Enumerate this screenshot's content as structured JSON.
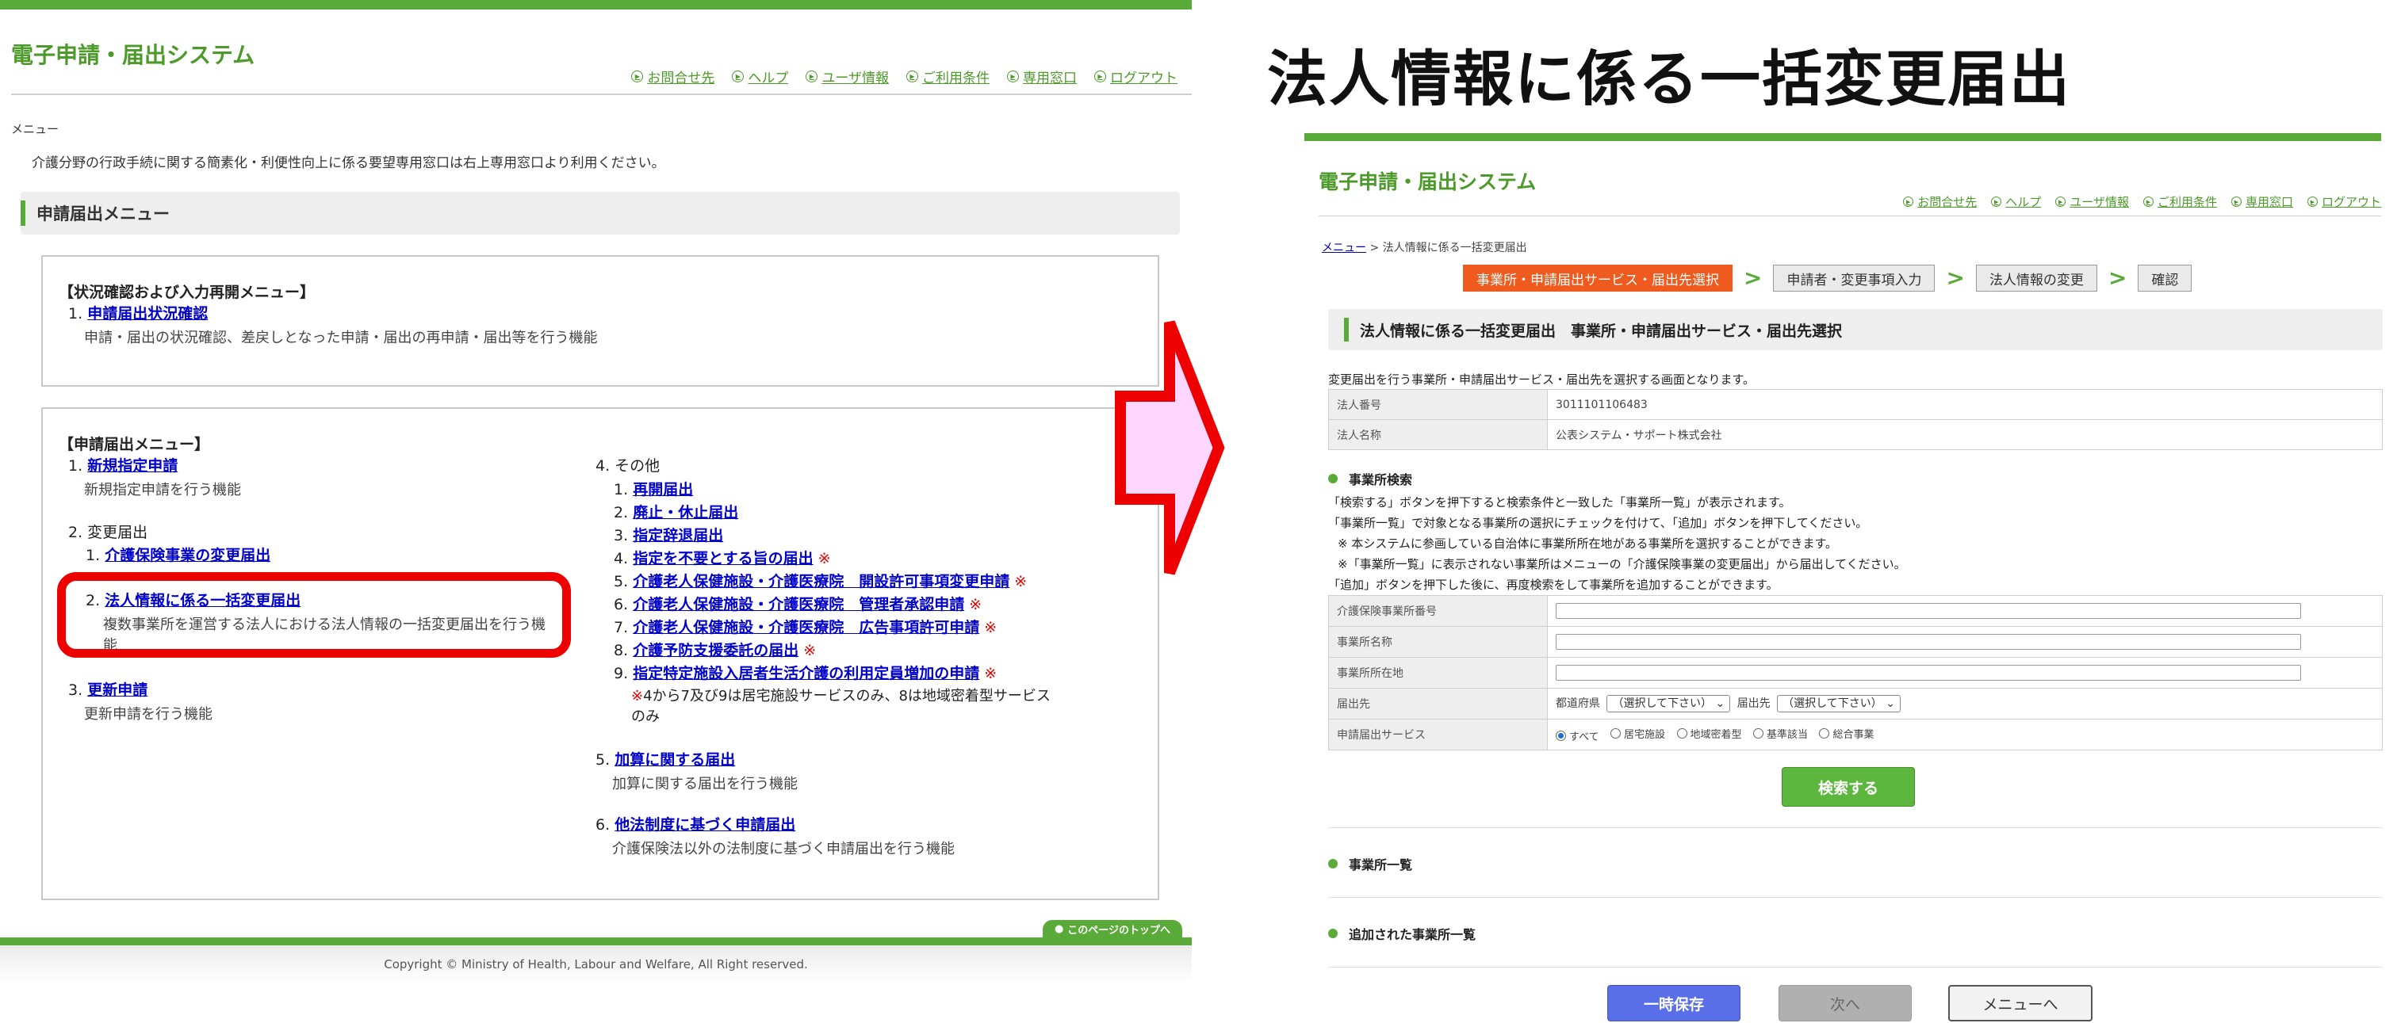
{
  "colors": {
    "brand_green": "#5aaa3a",
    "link_blue": "#0000cc",
    "highlight_red": "#ee0000",
    "arrow_fill": "#ffd6ff",
    "step_active": "#ef5a1e",
    "search_button": "#5db73e",
    "save_button": "#5a6ee8"
  },
  "left": {
    "system_title": "電子申請・届出システム",
    "toplinks": [
      {
        "label": "お問合せ先",
        "icon": "circle-arrow-icon"
      },
      {
        "label": "ヘルプ",
        "icon": "circle-arrow-icon"
      },
      {
        "label": "ユーザ情報",
        "icon": "circle-arrow-icon"
      },
      {
        "label": "ご利用条件",
        "icon": "circle-arrow-icon"
      },
      {
        "label": "専用窓口",
        "icon": "circle-arrow-icon"
      },
      {
        "label": "ログアウト",
        "icon": "circle-arrow-icon"
      }
    ],
    "menu_label": "メニュー",
    "notice": "介護分野の行政手続に関する簡素化・利便性向上に係る要望専用窓口は右上専用窓口より利用ください。",
    "section_title": "申請届出メニュー",
    "status_box": {
      "title": "【状況確認および入力再開メニュー】",
      "item_num": "1.",
      "item_link": "申請届出状況確認",
      "item_desc": "申請・届出の状況確認、差戻しとなった申請・届出の再申請・届出等を行う機能"
    },
    "menu_box": {
      "title": "【申請届出メニュー】",
      "i1_num": "1.",
      "i1_link": "新規指定申請",
      "i1_desc": "新規指定申請を行う機能",
      "i2_label": "2. 変更届出",
      "i2_1_num": "1.",
      "i2_1_link": "介護保険事業の変更届出",
      "i2_2_num": "2.",
      "i2_2_link": "法人情報に係る一括変更届出",
      "i2_2_desc_1": "複数事業所を運営する法人における法人情報の一括変更届出を行う機",
      "i2_2_desc_2": "能",
      "i3_num": "3.",
      "i3_link": "更新申請",
      "i3_desc": "更新申請を行う機能",
      "i4_label": "4. その他",
      "others": [
        {
          "num": "1.",
          "link": "再開届出",
          "mark": ""
        },
        {
          "num": "2.",
          "link": "廃止・休止届出",
          "mark": ""
        },
        {
          "num": "3.",
          "link": "指定辞退届出",
          "mark": ""
        },
        {
          "num": "4.",
          "link": "指定を不要とする旨の届出",
          "mark": "※"
        },
        {
          "num": "5.",
          "link": "介護老人保健施設・介護医療院　開設許可事項変更申請",
          "mark": "※"
        },
        {
          "num": "6.",
          "link": "介護老人保健施設・介護医療院　管理者承認申請",
          "mark": "※"
        },
        {
          "num": "7.",
          "link": "介護老人保健施設・介護医療院　広告事項許可申請",
          "mark": "※"
        },
        {
          "num": "8.",
          "link": "介護予防支援委託の届出",
          "mark": "※"
        },
        {
          "num": "9.",
          "link": "指定特定施設入居者生活介護の利用定員増加の申請",
          "mark": "※"
        }
      ],
      "note_mark": "※",
      "note_1": "4から7及び9は居宅施設サービスのみ、8は地域密着型サービス",
      "note_2": "のみ",
      "i5_num": "5.",
      "i5_link": "加算に関する届出",
      "i5_desc": "加算に関する届出を行う機能",
      "i6_num": "6.",
      "i6_link": "他法制度に基づく申請届出",
      "i6_desc": "介護保険法以外の法制度に基づく申請届出を行う機能"
    },
    "page_top": "このページのトップへ",
    "copyright": "Copyright © Ministry of Health, Labour and Welfare, All Right reserved."
  },
  "right": {
    "big_title": "法人情報に係る一括変更届出",
    "system_title": "電子申請・届出システム",
    "toplinks": [
      "お問合せ先",
      "ヘルプ",
      "ユーザ情報",
      "ご利用条件",
      "専用窓口",
      "ログアウト"
    ],
    "breadcrumb_link": "メニュー",
    "breadcrumb_sep": ">",
    "breadcrumb_current": "法人情報に係る一括変更届出",
    "steps": [
      "事業所・申請届出サービス・届出先選択",
      "申請者・変更事項入力",
      "法人情報の変更",
      "確認"
    ],
    "section_title": "法人情報に係る一括変更届出　事業所・申請届出サービス・届出先選択",
    "intro": "変更届出を行う事業所・申請届出サービス・届出先を選択する画面となります。",
    "corp_no_label": "法人番号",
    "corp_no_value": "3011101106483",
    "corp_name_label": "法人名称",
    "corp_name_value": "公表システム・サポート株式会社",
    "search_head": "事業所検索",
    "search_notes": [
      "「検索する」ボタンを押下すると検索条件と一致した「事業所一覧」が表示されます。",
      "「事業所一覧」で対象となる事業所の選択にチェックを付けて、「追加」ボタンを押下してください。",
      "※ 本システムに参画している自治体に事業所所在地がある事業所を選択することができます。",
      "※「事業所一覧」に表示されない事業所はメニューの「介護保険事業の変更届出」から届出してください。",
      "「追加」ボタンを押下した後に、再度検索をして事業所を追加することができます。"
    ],
    "form": {
      "office_no_label": "介護保険事業所番号",
      "office_name_label": "事業所名称",
      "office_addr_label": "事業所所在地",
      "dest_label": "届出先",
      "pref_label": "都道府県",
      "pref_select": "（選択して下さい）",
      "dest_sub_label": "届出先",
      "dest_select": "（選択して下さい）",
      "service_label": "申請届出サービス",
      "service_options": [
        "すべて",
        "居宅施設",
        "地域密着型",
        "基準該当",
        "総合事業"
      ],
      "service_selected": "すべて"
    },
    "search_button": "検索する",
    "office_list_head": "事業所一覧",
    "added_list_head": "追加された事業所一覧",
    "save_button": "一時保存",
    "next_button": "次へ",
    "menu_button": "メニューへ"
  }
}
